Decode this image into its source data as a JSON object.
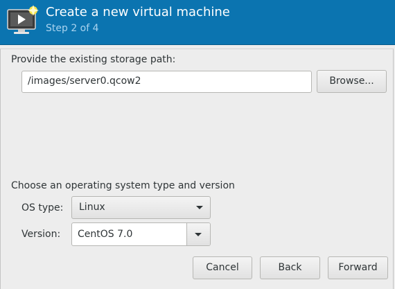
{
  "header": {
    "title": "Create a new virtual machine",
    "subtitle": "Step 2 of 4",
    "icon": "new-vm-icon",
    "background_color": "#0b74b0"
  },
  "storage": {
    "label": "Provide the existing storage path:",
    "path_value": "/images/server0.qcow2",
    "browse_label": "Browse..."
  },
  "os": {
    "section_label": "Choose an operating system type and version",
    "type_label": "OS type:",
    "type_value": "Linux",
    "version_label": "Version:",
    "version_value": "CentOS 7.0"
  },
  "actions": {
    "cancel_label": "Cancel",
    "back_label": "Back",
    "forward_label": "Forward"
  }
}
